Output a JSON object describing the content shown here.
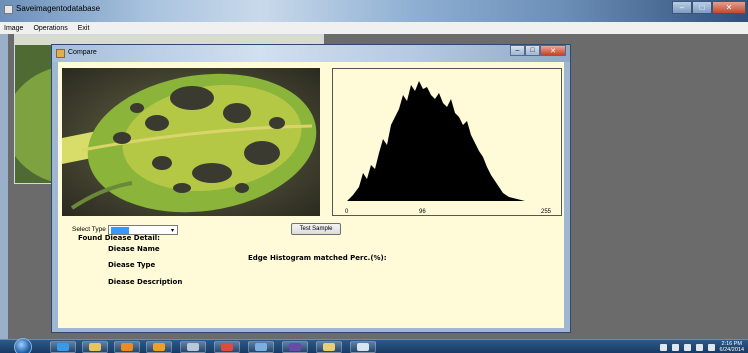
{
  "main_window": {
    "title": "Saveimagentodatabase",
    "controls": {
      "minimize": "‒",
      "maximize": "□",
      "close": "✕"
    }
  },
  "menubar": {
    "items": [
      {
        "label": "Image"
      },
      {
        "label": "Operations"
      },
      {
        "label": "Exit"
      }
    ]
  },
  "dialog": {
    "title": "Compare",
    "controls": {
      "minimize": "‒",
      "maximize": "□",
      "close": "✕"
    }
  },
  "histogram": {
    "ticks": [
      "0",
      "96",
      "255"
    ]
  },
  "form": {
    "select_type_label": "Select Type",
    "select_type_value": "",
    "test_button": "Test Sample",
    "found_header": "Found Diease Detail:",
    "disease_name_label": "Diease Name",
    "disease_type_label": "Diease Type",
    "disease_description_label": "Diease Description",
    "edge_histogram_label": "Edge Histogram matched Perc.(%):"
  },
  "taskbar": {
    "buttons": [
      {
        "icon": "internet-explorer-icon",
        "color": "#3a9ae8"
      },
      {
        "icon": "folder-icon",
        "color": "#e9c45a"
      },
      {
        "icon": "vlc-icon",
        "color": "#f08a1c"
      },
      {
        "icon": "media-player-icon",
        "color": "#f0a020"
      },
      {
        "icon": "calculator-icon",
        "color": "#b8c8d8"
      },
      {
        "icon": "chrome-icon",
        "color": "#e04a3a"
      },
      {
        "icon": "paint-icon",
        "color": "#7ab0e0"
      },
      {
        "icon": "visual-studio-icon",
        "color": "#6a4aa8"
      },
      {
        "icon": "explorer-window-icon",
        "color": "#e8d070"
      },
      {
        "icon": "application-icon",
        "color": "#d8e4f0"
      }
    ],
    "clock_time": "2:16 PM",
    "clock_date": "6/24/2014"
  }
}
